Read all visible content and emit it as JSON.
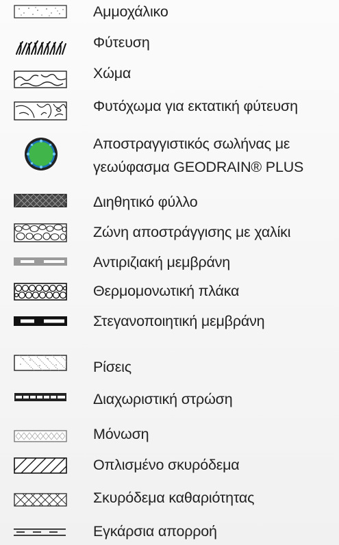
{
  "legend": {
    "items": [
      {
        "icon": "sand-gravel-icon",
        "label": "Αμμοχάλικο"
      },
      {
        "icon": "vegetation-icon",
        "label": "Φύτευση"
      },
      {
        "icon": "soil-icon",
        "label": "Χώμα"
      },
      {
        "icon": "topsoil-icon",
        "label": "Φυτόχωμα για εκτατική φύτευση"
      },
      {
        "icon": "drain-pipe-icon",
        "label": "Αποστραγγιστικός σωλήνας με",
        "label2": "γεωύφασμα GEODRAIN® PLUS"
      },
      {
        "icon": "filter-sheet-icon",
        "label": "Διηθητικό φύλλο"
      },
      {
        "icon": "gravel-drainage-icon",
        "label": "Ζώνη αποστράγγισης με χαλίκι"
      },
      {
        "icon": "root-barrier-icon",
        "label": "Αντιριζιακή μεμβράνη"
      },
      {
        "icon": "insulation-board-icon",
        "label": "Θερμομονωτική πλάκα"
      },
      {
        "icon": "waterproof-membrane-icon",
        "label": "Στεγανοποιητική μεμβράνη"
      },
      {
        "icon": "screed-icon",
        "label": "Ρίσεις"
      },
      {
        "icon": "separation-layer-icon",
        "label": "Διαχωριστική στρώση"
      },
      {
        "icon": "insulation-icon",
        "label": "Μόνωση"
      },
      {
        "icon": "reinforced-concrete-icon",
        "label": "Οπλισμένο σκυρόδεμα"
      },
      {
        "icon": "lean-concrete-icon",
        "label": "Σκυρόδεμα καθαριότητας"
      },
      {
        "icon": "transverse-drainage-icon",
        "label": "Εγκάρσια απορροή"
      }
    ]
  },
  "colors": {
    "pipe_fill": "#3fb54a",
    "pipe_ring": "#1a75bb",
    "ink": "#1a1a1a",
    "dark_fill": "#555555"
  }
}
